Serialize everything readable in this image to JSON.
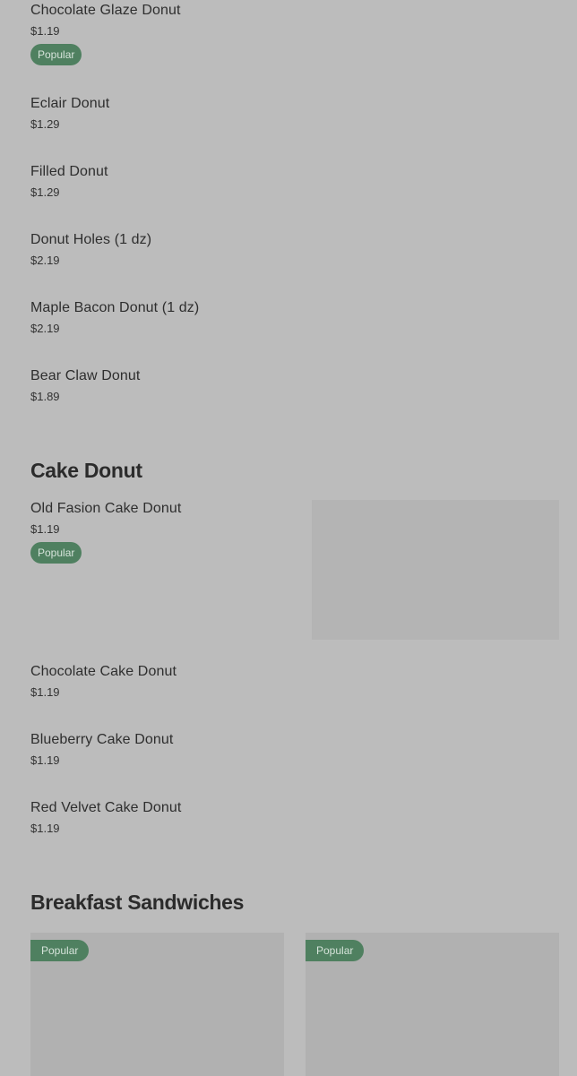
{
  "donuts": [
    {
      "name": "Chocolate Glaze Donut",
      "price": "$1.19",
      "badge": "Popular"
    },
    {
      "name": "Eclair Donut",
      "price": "$1.29"
    },
    {
      "name": "Filled Donut",
      "price": "$1.29"
    },
    {
      "name": "Donut Holes (1 dz)",
      "price": "$2.19"
    },
    {
      "name": "Maple Bacon Donut (1 dz)",
      "price": "$2.19"
    },
    {
      "name": "Bear Claw Donut",
      "price": "$1.89"
    }
  ],
  "cake_section": {
    "title": "Cake Donut",
    "items": [
      {
        "name": "Old Fasion Cake Donut",
        "price": "$1.19",
        "badge": "Popular"
      },
      {
        "name": "Chocolate Cake Donut",
        "price": "$1.19"
      },
      {
        "name": "Blueberry Cake Donut",
        "price": "$1.19"
      },
      {
        "name": "Red Velvet Cake Donut",
        "price": "$1.19"
      }
    ]
  },
  "breakfast_section": {
    "title": "Breakfast Sandwiches",
    "cards": [
      {
        "badge": "Popular"
      },
      {
        "badge": "Popular"
      }
    ]
  }
}
